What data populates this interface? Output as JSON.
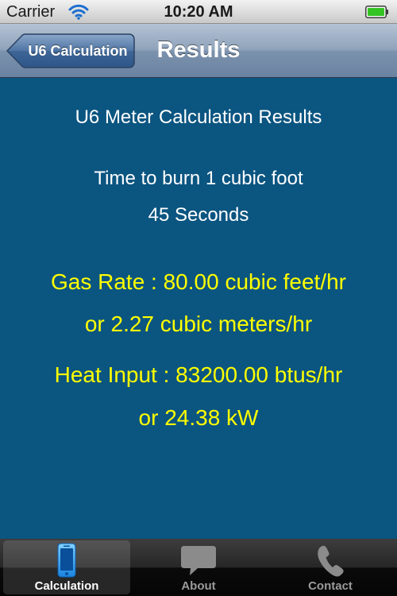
{
  "status_bar": {
    "carrier": "Carrier",
    "time": "10:20 AM",
    "wifi_icon": "wifi-icon",
    "battery_icon": "battery-icon"
  },
  "nav_bar": {
    "back_label": "U6 Calculation",
    "title": "Results"
  },
  "results": {
    "heading": "U6 Meter Calculation Results",
    "time_label": "Time to burn 1 cubic foot",
    "time_value": "45 Seconds",
    "gas_rate_line": "Gas Rate : 80.00 cubic feet/hr",
    "gas_rate_metric_line": "or 2.27 cubic meters/hr",
    "heat_input_line": "Heat Input : 83200.00 btus/hr",
    "heat_input_kw_line": "or 24.38 kW"
  },
  "tab_bar": {
    "tabs": [
      {
        "label": "Calculation",
        "icon": "phone-icon",
        "selected": true
      },
      {
        "label": "About",
        "icon": "speech-bubble-icon",
        "selected": false
      },
      {
        "label": "Contact",
        "icon": "telephone-handset-icon",
        "selected": false
      }
    ]
  },
  "colors": {
    "content_background": "#0b5581",
    "result_text": "#ffffff",
    "highlight_text": "#ffff00",
    "battery_fill": "#34c424"
  }
}
